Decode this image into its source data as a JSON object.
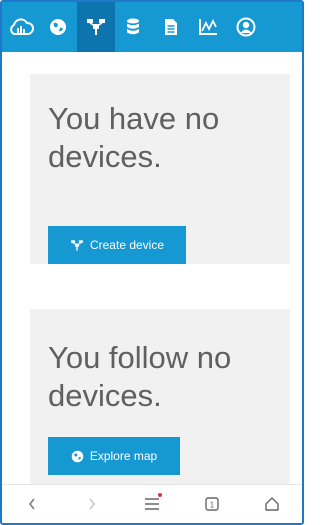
{
  "colors": {
    "brand": "#1698d2",
    "brand_active": "#0e74ae",
    "panel_bg": "#f1f1f1",
    "heading_text": "#606060",
    "notification_dot": "#e53935"
  },
  "topbar": {
    "items": [
      {
        "icon": "cloud-logo-icon",
        "active": false
      },
      {
        "icon": "globe-icon",
        "active": false
      },
      {
        "icon": "devices-network-icon",
        "active": true
      },
      {
        "icon": "database-icon",
        "active": false
      },
      {
        "icon": "document-icon",
        "active": false
      },
      {
        "icon": "chart-icon",
        "active": false
      },
      {
        "icon": "user-icon",
        "active": false
      }
    ]
  },
  "devices_panel": {
    "heading": "You have no devices.",
    "button_label": "Create device",
    "button_icon": "devices-network-icon"
  },
  "followed_panel": {
    "heading": "You follow no devices.",
    "button_label": "Explore map",
    "button_icon": "globe-icon"
  },
  "bottombar": {
    "items": [
      {
        "icon": "back-chevron-icon"
      },
      {
        "icon": "forward-chevron-icon"
      },
      {
        "icon": "menu-icon",
        "has_notification": true
      },
      {
        "icon": "tabs-icon",
        "tab_count": "1"
      },
      {
        "icon": "home-icon"
      }
    ]
  }
}
